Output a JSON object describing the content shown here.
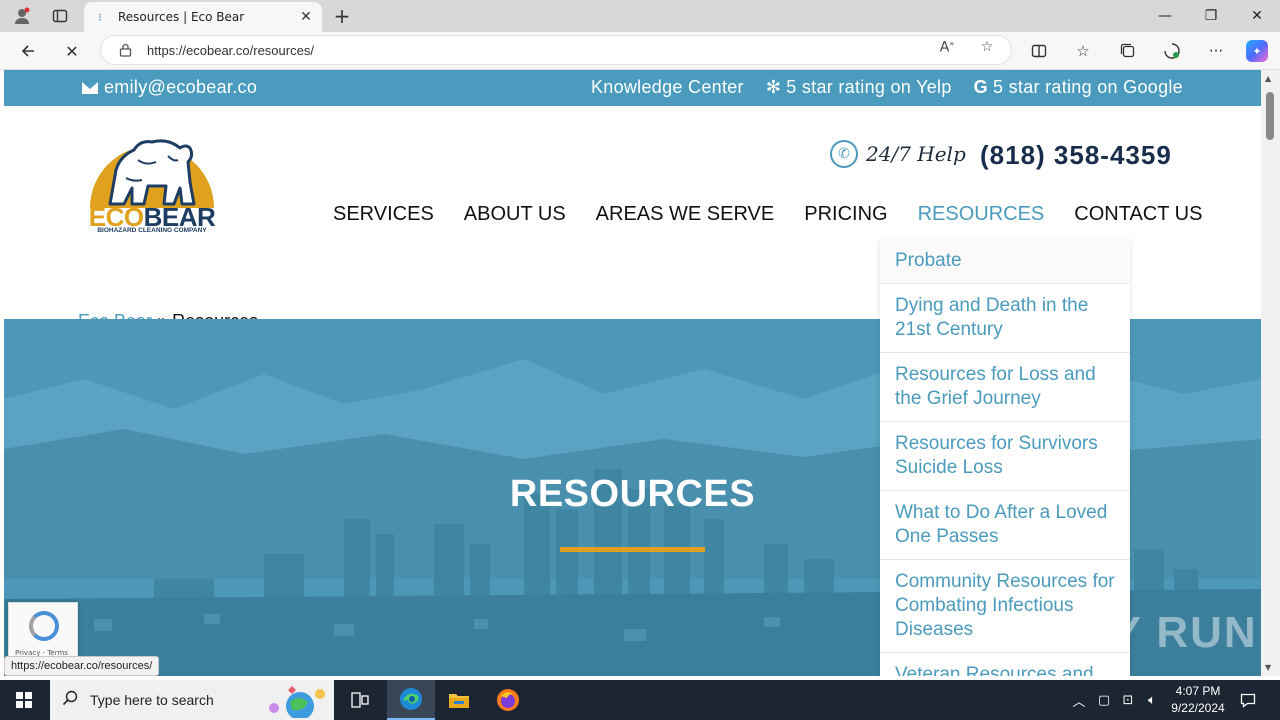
{
  "browser": {
    "tab_title": "Resources | Eco Bear",
    "url": "https://ecobear.co/resources/",
    "status_url": "https://ecobear.co/resources/"
  },
  "topbar": {
    "email": "emily@ecobear.co",
    "knowledge_center": "Knowledge Center",
    "yelp": "5 star rating on Yelp",
    "google": "5 star rating on Google"
  },
  "logo": {
    "eco": "ECO",
    "bear": "BEAR",
    "subtitle": "BIOHAZARD CLEANING COMPANY"
  },
  "header": {
    "help_text": "24/7 Help",
    "phone": "(818) 358-4359"
  },
  "nav": {
    "items": [
      {
        "label": "SERVICES"
      },
      {
        "label": "ABOUT US"
      },
      {
        "label": "AREAS WE SERVE"
      },
      {
        "label": "PRICING"
      },
      {
        "label": "RESOURCES"
      },
      {
        "label": "CONTACT US"
      }
    ]
  },
  "breadcrumb": {
    "home": "Eco Bear",
    "separator": "»",
    "current": "Resources"
  },
  "hero": {
    "title": "RESOURCES"
  },
  "dropdown": {
    "items": [
      {
        "label": "Probate"
      },
      {
        "label": "Dying and Death in the 21st Century"
      },
      {
        "label": "Resources for Loss and the Grief Journey"
      },
      {
        "label": "Resources for Survivors Suicide Loss"
      },
      {
        "label": "What to Do After a Loved One Passes"
      },
      {
        "label": "Community Resources for Combating Infectious Diseases"
      },
      {
        "label": "Veteran Resources and"
      }
    ]
  },
  "recaptcha": {
    "text": "Privacy - Terms"
  },
  "watermark": "ANY RUN",
  "taskbar": {
    "search_placeholder": "Type here to search",
    "time": "4:07 PM",
    "date": "9/22/2024"
  },
  "colors": {
    "accent": "#4a9bbd",
    "gold": "#e0a21e",
    "navy": "#1d3d63"
  }
}
